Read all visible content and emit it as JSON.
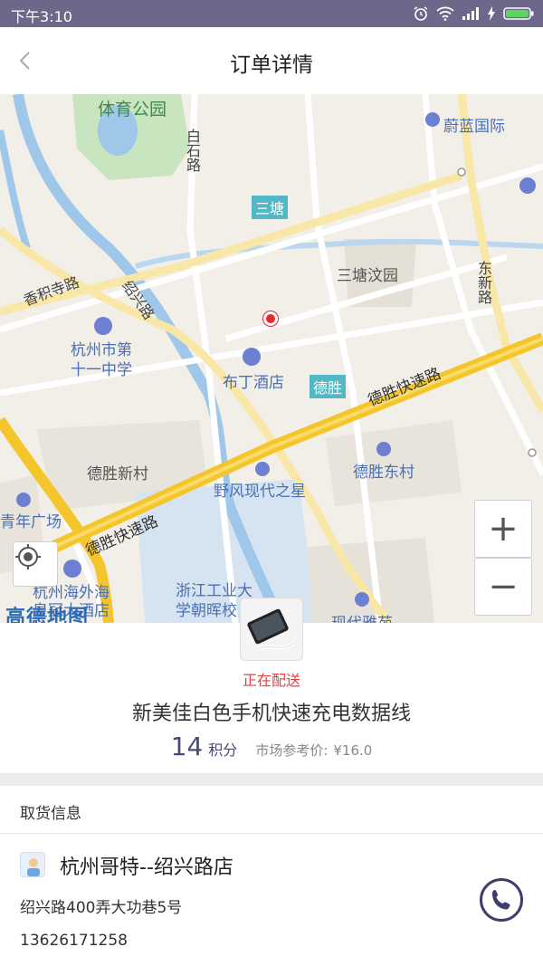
{
  "status_bar": {
    "time": "下午3:10",
    "icons": [
      "alarm-icon",
      "wifi-icon",
      "signal-icon",
      "charging-icon",
      "battery-icon"
    ]
  },
  "nav": {
    "title": "订单详情",
    "back_icon": "chevron-left-icon"
  },
  "map": {
    "pois": [
      "体育公园",
      "蔚蓝国际",
      "三塘汶园",
      "杭州市第",
      "十一中学",
      "布丁酒店",
      "德胜新村",
      "野风现代之星",
      "德胜东村",
      "青年广场",
      "杭州海外海",
      "皇冠大酒店",
      "浙江工业大",
      "学朝晖校",
      "现代雅苑"
    ],
    "badges": [
      "三塘",
      "德胜"
    ],
    "roads": [
      "白石路",
      "香积寺路",
      "绍兴路",
      "东新路",
      "德胜快速路",
      "德胜快速路"
    ],
    "logo": "高德地图",
    "zoom_in": "+",
    "zoom_out": "−"
  },
  "product": {
    "status": "正在配送",
    "name": "新美佳白色手机快速充电数据线",
    "points": "14",
    "points_unit": "积分",
    "market_label": "市场参考价:",
    "market_price": "¥16.0"
  },
  "pickup": {
    "section_title": "取货信息",
    "store_name": "杭州哥特--绍兴路店",
    "address": "绍兴路400弄大功巷5号",
    "phone": "13626171258"
  },
  "colors": {
    "status_bar": "#6d6889",
    "status_text": "#e54040",
    "points": "#4a4a7a",
    "highway": "#f4c62c",
    "water": "#9ec7ea"
  }
}
